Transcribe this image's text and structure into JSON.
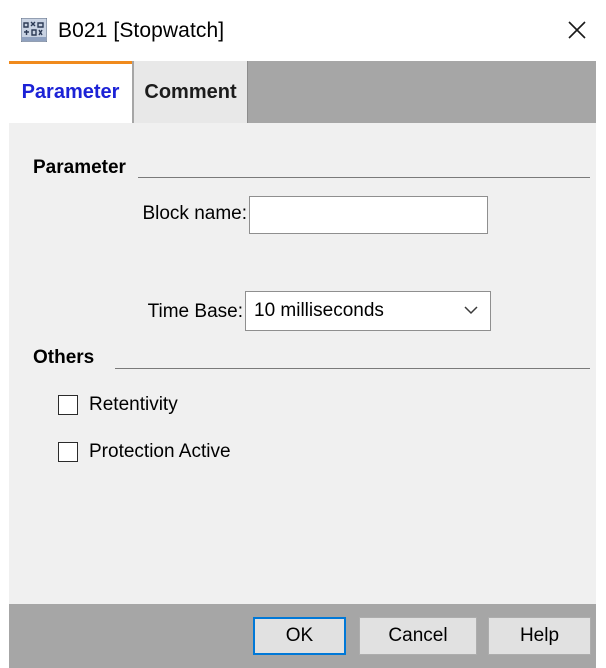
{
  "window": {
    "title": "B021 [Stopwatch]",
    "app_icon": "grid-app-icon",
    "close_icon": "close-icon"
  },
  "tabs": [
    {
      "label": "Parameter",
      "active": true
    },
    {
      "label": "Comment",
      "active": false
    }
  ],
  "parameter_section": {
    "title": "Parameter",
    "block_name": {
      "label": "Block name:",
      "value": "",
      "placeholder": ""
    },
    "time_base": {
      "label": "Time Base:",
      "selected": "10 milliseconds"
    }
  },
  "others_section": {
    "title": "Others",
    "checkboxes": [
      {
        "label": "Retentivity",
        "checked": false
      },
      {
        "label": "Protection Active",
        "checked": false
      }
    ]
  },
  "buttons": {
    "ok": "OK",
    "cancel": "Cancel",
    "help": "Help"
  },
  "colors": {
    "active_tab_text": "#1c22d6",
    "active_tab_accent": "#f08a1c",
    "default_button_border": "#0078d7",
    "bar_background": "#a6a6a6",
    "panel_background": "#f0f0f0"
  }
}
